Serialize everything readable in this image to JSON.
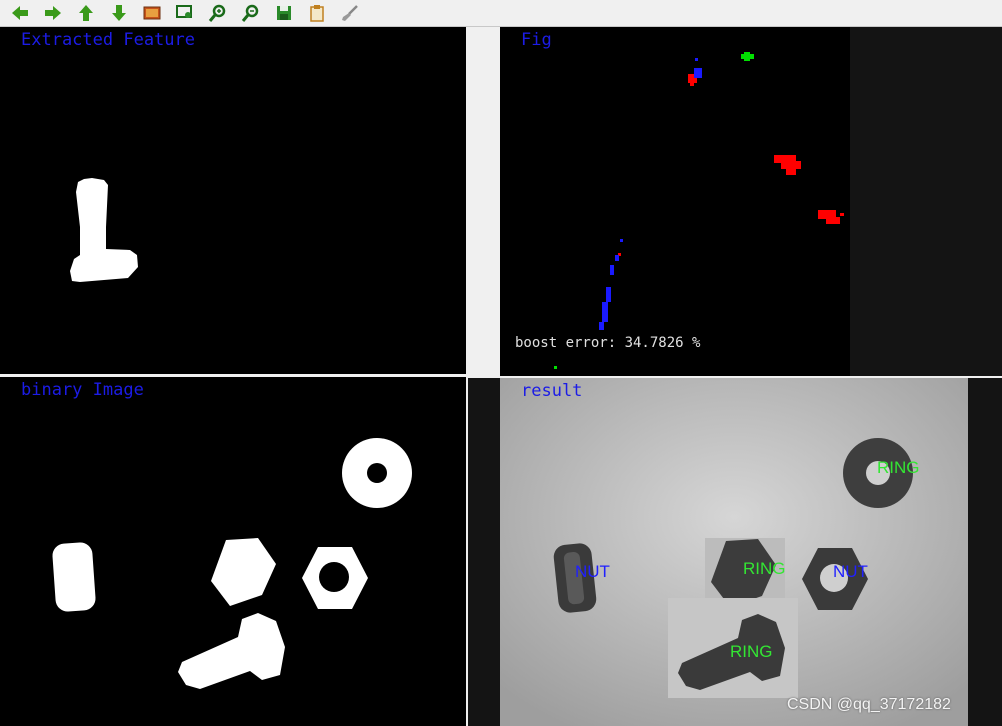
{
  "toolbar": {
    "buttons": [
      {
        "name": "pan-left-button",
        "icon": "arrow-left-icon"
      },
      {
        "name": "pan-right-button",
        "icon": "arrow-right-icon"
      },
      {
        "name": "pan-up-button",
        "icon": "arrow-up-icon"
      },
      {
        "name": "pan-down-button",
        "icon": "arrow-down-icon"
      },
      {
        "name": "zoom-original-button",
        "icon": "image-icon"
      },
      {
        "name": "zoom-fit-button",
        "icon": "zoom-fit-icon"
      },
      {
        "name": "zoom-in-button",
        "icon": "zoom-in-icon"
      },
      {
        "name": "zoom-out-button",
        "icon": "zoom-out-icon"
      },
      {
        "name": "save-button",
        "icon": "save-icon"
      },
      {
        "name": "copy-button",
        "icon": "clipboard-icon"
      },
      {
        "name": "properties-button",
        "icon": "brush-icon"
      }
    ]
  },
  "windows": {
    "extracted_feature": {
      "title": "Extracted Feature"
    },
    "fig": {
      "title": "Fig",
      "boost_error": "boost error: 34.7826 %"
    },
    "binary_image": {
      "title": "binary Image"
    },
    "result": {
      "title": "result",
      "labels": {
        "ring_top": "RING",
        "nut_left": "NUT",
        "ring_middle": "RING",
        "nut_right": "NUT",
        "ring_bolt": "RING"
      }
    }
  },
  "watermark": "CSDN @qq_37172182",
  "colors": {
    "caption": "#1c1ce6",
    "ring_label": "#33e633",
    "nut_label": "#2020ff",
    "background": "#000000"
  }
}
